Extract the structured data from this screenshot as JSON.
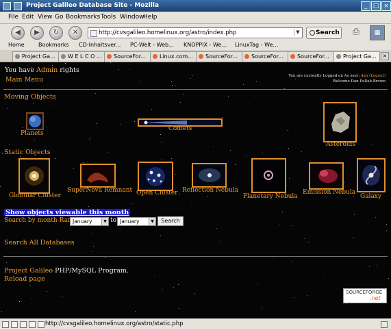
{
  "window": {
    "title": "Project Galileo Database Site - Mozilla",
    "min": "_",
    "max": "□",
    "close": "×"
  },
  "menu": [
    "File",
    "Edit",
    "View",
    "Go",
    "Bookmarks",
    "Tools",
    "Window",
    "Help"
  ],
  "nav": {
    "url": "http://cvsgalileo.homelinux.org/astro/index.php",
    "search_label": "Search"
  },
  "bookmarks": [
    "Home",
    "Bookmarks",
    "CD-Inhaltsver...",
    "PC-Welt - Web...",
    "KNOPPIX - We...",
    "LinuxTag - We..."
  ],
  "tabs": [
    "Project Ga...",
    "W E L C O ...",
    "SourceFor...",
    "Linux.com...",
    "SourceFor...",
    "SourceFor...",
    "SourceFor...",
    "Project Ga..."
  ],
  "page": {
    "rights_prefix": "You have",
    "rights_role": "Admin",
    "rights_suffix": "rights",
    "main_menu": "Main Menu",
    "login_line1_prefix": "You are currently Logged on As user:",
    "login_user": "dan",
    "login_logout": "(Logout)",
    "login_line2": "Welcome Dan Pullah Brown",
    "moving_heading": "Moving Objects",
    "moving": [
      {
        "label": "Planets"
      },
      {
        "label": "Comets"
      },
      {
        "label": "Asteroids"
      }
    ],
    "static_heading": "Static Objects",
    "static": [
      {
        "label": "Globular Cluster"
      },
      {
        "label": "SuperNova Remnant"
      },
      {
        "label": "Open Cluster"
      },
      {
        "label": "Reflection Nebula"
      },
      {
        "label": "Planetary Nebula"
      },
      {
        "label": "Emission Nebula"
      },
      {
        "label": "Galaxy"
      }
    ],
    "show_viewable": "Show objects viewable this month",
    "search_range_label": "Search by month Range",
    "month_from": "January",
    "to_label": "to",
    "month_to": "January",
    "search_button": "Search",
    "search_all": "Search All Databases",
    "footer_project": "Project Galileo",
    "footer_program": "PHP/MySQL Program.",
    "reload": "Reload page",
    "sf_badge_top": "SOURCEFORGE",
    "sf_badge_bottom": ".net"
  },
  "status": {
    "text": "http://cvsgalileo.homelinux.org/astro/static.php"
  }
}
